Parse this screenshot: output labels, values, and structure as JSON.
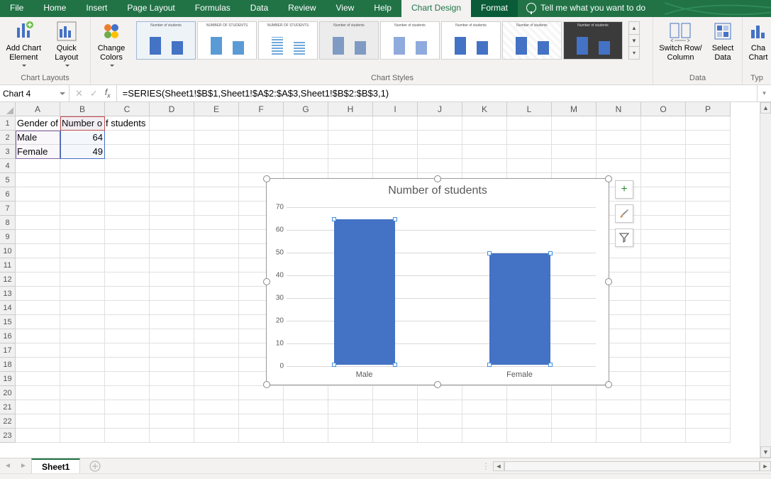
{
  "menu": {
    "file": "File",
    "home": "Home",
    "insert": "Insert",
    "pagelayout": "Page Layout",
    "formulas": "Formulas",
    "data": "Data",
    "review": "Review",
    "view": "View",
    "help": "Help",
    "chartdesign": "Chart Design",
    "format": "Format",
    "tellme": "Tell me what you want to do"
  },
  "ribbon": {
    "add_chart_element": "Add Chart Element",
    "quick_layout": "Quick Layout",
    "change_colors": "Change Colors",
    "group_chart_layouts": "Chart Layouts",
    "group_chart_styles": "Chart Styles",
    "switch_row_column": "Switch Row/ Column",
    "select_data": "Select Data",
    "group_data": "Data",
    "change_chart_type": "Cha Chart",
    "group_type": "Typ"
  },
  "namebox": "Chart 4",
  "formula": "=SERIES(Sheet1!$B$1,Sheet1!$A$2:$A$3,Sheet1!$B$2:$B$3,1)",
  "columns": [
    "A",
    "B",
    "C",
    "D",
    "E",
    "F",
    "G",
    "H",
    "I",
    "J",
    "K",
    "L",
    "M",
    "N",
    "O",
    "P"
  ],
  "rowcount": 23,
  "cells": {
    "A1": "Gender of",
    "B1": "Number o",
    "B1_spill": "f students",
    "A2": "Male",
    "B2": "64",
    "A3": "Female",
    "B3": "49"
  },
  "chart_data": {
    "type": "bar",
    "title": "Number of students",
    "categories": [
      "Male",
      "Female"
    ],
    "values": [
      64,
      49
    ],
    "ylim": [
      0,
      70
    ],
    "ystep": 10,
    "xlabel": "",
    "ylabel": ""
  },
  "chart_side": {
    "plus": "+",
    "brush": "",
    "filter": ""
  },
  "sheet_tab": "Sheet1"
}
